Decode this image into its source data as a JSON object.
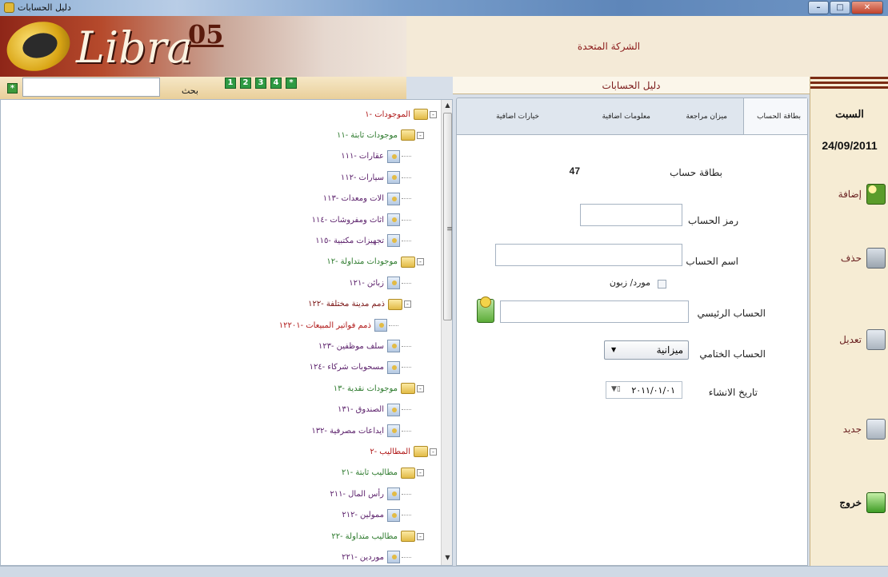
{
  "window": {
    "title": "دليل الحسابات"
  },
  "header": {
    "logo_text": "Libra",
    "logo_version": "05",
    "company": "الشركة المتحدة"
  },
  "toolbar": {
    "search_label": "بحث",
    "search_value": "",
    "levels": [
      "1",
      "2",
      "3",
      "4",
      "*"
    ],
    "expand_symbol": "*"
  },
  "tree": [
    {
      "label": "الموجودات -١",
      "kind": "folder",
      "color": "red",
      "exp": "-"
    },
    {
      "label": "موجودات ثابتة -١١",
      "kind": "folder",
      "color": "green",
      "exp": "-"
    },
    {
      "label": "عقارات -١١١",
      "kind": "doc",
      "color": "purple"
    },
    {
      "label": "سيارات -١١٢",
      "kind": "doc",
      "color": "purple"
    },
    {
      "label": "الات ومعدات -١١٣",
      "kind": "doc",
      "color": "purple"
    },
    {
      "label": "اثاث ومفروشات -١١٤",
      "kind": "doc",
      "color": "purple"
    },
    {
      "label": "تجهيزات مكتبية -١١٥",
      "kind": "doc",
      "color": "purple"
    },
    {
      "label": "موجودات متداولة -١٢",
      "kind": "folder",
      "color": "green",
      "exp": "-"
    },
    {
      "label": "زبائن -١٢١",
      "kind": "doc",
      "color": "purple"
    },
    {
      "label": "ذمم مدينة مختلفة -١٢٢",
      "kind": "folder",
      "color": "dark",
      "exp": "-"
    },
    {
      "label": "ذمم فواتير المبيعات -١٢٢٠١",
      "kind": "doc",
      "color": "red"
    },
    {
      "label": "سلف موظفين -١٢٣",
      "kind": "doc",
      "color": "purple"
    },
    {
      "label": "مسحوبات شركاء -١٢٤",
      "kind": "doc",
      "color": "purple"
    },
    {
      "label": "موجودات نقدية -١٣",
      "kind": "folder",
      "color": "green",
      "exp": "-"
    },
    {
      "label": "الصندوق -١٣١",
      "kind": "doc",
      "color": "purple"
    },
    {
      "label": "ايداعات مصرفية -١٣٢",
      "kind": "doc",
      "color": "purple"
    },
    {
      "label": "المطاليب -٢",
      "kind": "folder",
      "color": "red",
      "exp": "-"
    },
    {
      "label": "مطاليب ثابتة -٢١",
      "kind": "folder",
      "color": "green",
      "exp": "-"
    },
    {
      "label": "رأس المال -٢١١",
      "kind": "doc",
      "color": "purple"
    },
    {
      "label": "ممولين -٢١٢",
      "kind": "doc",
      "color": "purple"
    },
    {
      "label": "مطاليب متداولة -٢٢",
      "kind": "folder",
      "color": "green",
      "exp": "-"
    },
    {
      "label": "موردين -٢٢١",
      "kind": "doc",
      "color": "purple"
    }
  ],
  "panel": {
    "title": "دليل الحسابات",
    "tabs": [
      "بطاقة الحساب",
      "ميزان مراجعة",
      "معلومات اضافية",
      "خيارات اضافية"
    ],
    "card_label": "بطاقة حساب",
    "card_number": "47",
    "account_code_label": "رمز الحساب",
    "account_code_value": "",
    "account_name_label": "اسم الحساب",
    "account_name_value": "",
    "supplier_customer_label": "مورد/ زبون",
    "main_account_label": "الحساب الرئيسي",
    "main_account_value": "",
    "final_account_label": "الحساب الختامي",
    "final_account_value": "ميزانية",
    "created_date_label": "تاريخ الانشاء",
    "created_date_value": "٢٠١١/٠١/٠١"
  },
  "sidebar": {
    "day": "السبت",
    "date": "24/09/2011",
    "actions": {
      "add": "إضافة",
      "delete": "حذف",
      "edit": "تعديل",
      "new": "جديد",
      "exit": "خروج"
    }
  },
  "colors": {
    "accent": "#8e2618",
    "tree_red": "#b01818",
    "tree_green": "#2d7a2d",
    "tree_purple": "#5a1f6a"
  }
}
